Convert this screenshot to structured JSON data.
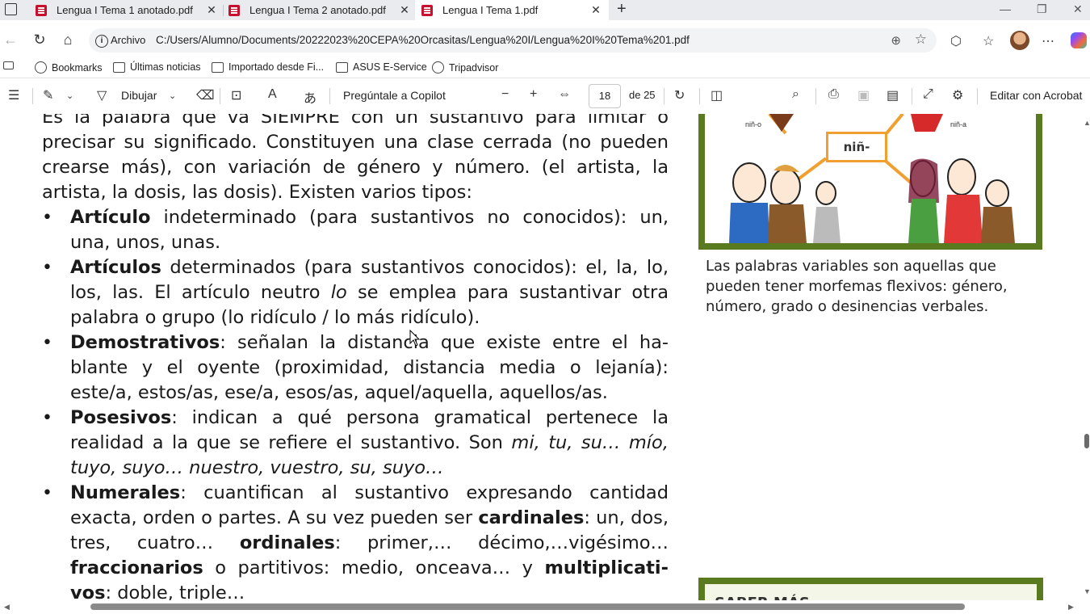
{
  "tabs": [
    {
      "label": "Lengua I Tema 1 anotado.pdf",
      "active": false
    },
    {
      "label": "Lengua I Tema 2 anotado.pdf",
      "active": false
    },
    {
      "label": "Lengua I Tema 1.pdf",
      "active": true
    }
  ],
  "address": {
    "label": "Archivo",
    "url": "C:/Users/Alumno/Documents/20222023%20CEPA%20Orcasitas/Lengua%20I/Lengua%20I%20Tema%201.pdf"
  },
  "bookmarks": [
    {
      "label": "Bookmarks",
      "icon": "globe-icon"
    },
    {
      "label": "Últimas noticias",
      "icon": "folder-icon"
    },
    {
      "label": "Importado desde Fi...",
      "icon": "folder-icon"
    },
    {
      "label": "ASUS E-Service",
      "icon": "folder-icon"
    },
    {
      "label": "Tripadvisor",
      "icon": "globe-icon"
    }
  ],
  "pdf_toolbar": {
    "draw_label": "Dibujar",
    "copilot_label": "Pregúntale a Copilot",
    "page_current": "18",
    "page_total": "de 25",
    "acrobat_label": "Editar con Acrobat"
  },
  "document": {
    "intro": "Es la palabra que va SIEMPRE con un sustantivo para limitar o precisar su significado. Constituyen una clase cerrada (no pueden crearse más), con variación de género y número. (el artista, la artista, la dosis, las dosis). Existen varios tipos:",
    "items": [
      {
        "term": "Artículo",
        "text": " indeterminado (para sustantivos no conocidos): un, una, unos, unas."
      },
      {
        "term": "Artículos",
        "text": " determinados (para sustantivos conocidos): el, la, lo, los, las. El artículo neutro ",
        "italic": "lo",
        "text2": " se emplea para sustantivar otra palabra o grupo (lo ridículo / lo más ridículo)."
      },
      {
        "term": "Demostrativos",
        "text": ": señalan la distancia que existe entre el ha-blante y el oyente (proximidad, distancia media o lejanía): este/a, estos/as, ese/a, esos/as, aquel/aquella, aquellos/as."
      },
      {
        "term": "Posesivos",
        "text": ": indican a qué persona gramatical pertenece la realidad a la que se refiere el sustantivo. Son ",
        "italic": "mi, tu, su… mío, tuyo, suyo… nuestro, vuestro, su, suyo…"
      },
      {
        "term": "Numerales",
        "text": ": cuantifican al sustantivo expresando cantidad exacta, orden o partes. A su vez pueden ser ",
        "b1": "cardinales",
        "t1": ": un, dos, tres, cuatro… ",
        "b2": "ordinales",
        "t2": ": primer,… décimo,…vigésimo… ",
        "b3": "fraccionarios",
        "t3": " o partitivos: medio, onceava… y ",
        "b4": "multiplicati-vos",
        "t4": ": doble, triple…"
      }
    ],
    "illustration": {
      "center_label": "niñ-",
      "left_tag": "niñ-o",
      "right_tag": "niñ-a"
    },
    "caption": "Las palabras variables son aquellas que pueden tener morfemas flexivos: género, número, grado o desinencias verbales.",
    "box_title": "SABER MÁS"
  }
}
